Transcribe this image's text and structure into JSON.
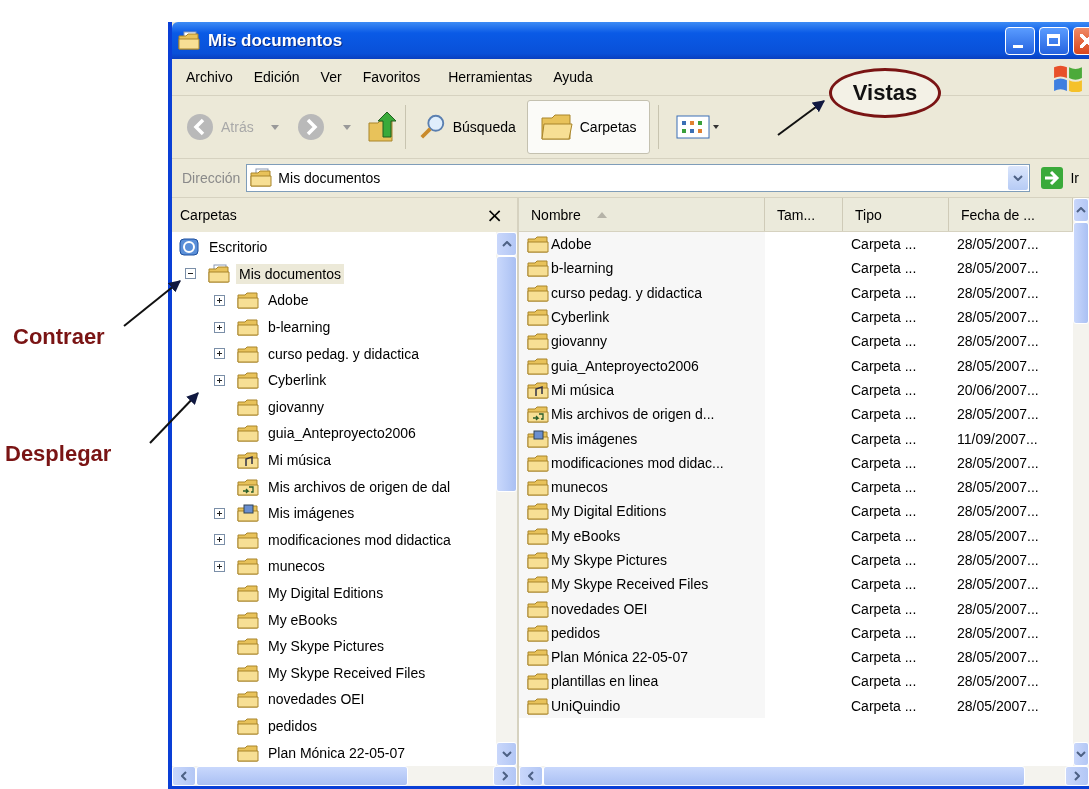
{
  "window": {
    "title": "Mis documentos"
  },
  "menu": [
    "Archivo",
    "Edición",
    "Ver",
    "Favoritos",
    "Herramientas",
    "Ayuda"
  ],
  "toolbar": {
    "back": {
      "label": "Atrás",
      "disabled": true
    },
    "forward": {
      "disabled": true
    },
    "search": {
      "label": "Búsqueda"
    },
    "folders": {
      "label": "Carpetas",
      "selected": true
    }
  },
  "address": {
    "label": "Dirección",
    "value": "Mis documentos",
    "go": "Ir"
  },
  "folders_pane": {
    "title": "Carpetas",
    "close": "×",
    "tree": [
      {
        "label": "Escritorio",
        "kind": "desktop",
        "selected": false,
        "children": [
          {
            "label": "Mis documentos",
            "kind": "documents",
            "selected": true,
            "expanded": true,
            "children": [
              {
                "label": "Adobe",
                "kind": "folder",
                "selected": false,
                "expanded": false
              },
              {
                "label": "b-learning",
                "kind": "folder",
                "selected": false,
                "expanded": false
              },
              {
                "label": "curso pedag. y didactica",
                "kind": "folder",
                "selected": false,
                "expanded": false
              },
              {
                "label": "Cyberlink",
                "kind": "folder",
                "selected": false,
                "expanded": false
              },
              {
                "label": "giovanny",
                "kind": "folder",
                "selected": false
              },
              {
                "label": "guia_Anteproyecto2006",
                "kind": "folder",
                "selected": false
              },
              {
                "label": "Mi música",
                "kind": "music",
                "selected": false
              },
              {
                "label": "Mis archivos de origen de dal",
                "kind": "shared",
                "selected": false
              },
              {
                "label": "Mis imágenes",
                "kind": "pictures",
                "selected": false,
                "expanded": false
              },
              {
                "label": "modificaciones mod didactica",
                "kind": "folder",
                "selected": false,
                "expanded": false
              },
              {
                "label": "munecos",
                "kind": "folder",
                "selected": false,
                "expanded": false
              },
              {
                "label": "My Digital Editions",
                "kind": "folder",
                "selected": false
              },
              {
                "label": "My eBooks",
                "kind": "folder",
                "selected": false
              },
              {
                "label": "My Skype Pictures",
                "kind": "folder",
                "selected": false
              },
              {
                "label": "My Skype Received Files",
                "kind": "folder",
                "selected": false
              },
              {
                "label": "novedades OEI",
                "kind": "folder",
                "selected": false
              },
              {
                "label": "pedidos",
                "kind": "folder",
                "selected": false
              },
              {
                "label": "Plan Mónica 22-05-07",
                "kind": "folder",
                "selected": false
              }
            ]
          }
        ]
      }
    ]
  },
  "file_list": {
    "columns": [
      {
        "label": "Nombre",
        "sorted": true
      },
      {
        "label": "Tam..."
      },
      {
        "label": "Tipo"
      },
      {
        "label": "Fecha de ..."
      }
    ],
    "rows": [
      {
        "name": "Adobe",
        "kind": "folder",
        "type": "Carpeta ...",
        "date": "28/05/2007..."
      },
      {
        "name": "b-learning",
        "kind": "folder",
        "type": "Carpeta ...",
        "date": "28/05/2007..."
      },
      {
        "name": "curso pedag. y didactica",
        "kind": "folder",
        "type": "Carpeta ...",
        "date": "28/05/2007..."
      },
      {
        "name": "Cyberlink",
        "kind": "folder",
        "type": "Carpeta ...",
        "date": "28/05/2007..."
      },
      {
        "name": "giovanny",
        "kind": "folder",
        "type": "Carpeta ...",
        "date": "28/05/2007..."
      },
      {
        "name": "guia_Anteproyecto2006",
        "kind": "folder",
        "type": "Carpeta ...",
        "date": "28/05/2007..."
      },
      {
        "name": "Mi música",
        "kind": "music",
        "type": "Carpeta ...",
        "date": "20/06/2007..."
      },
      {
        "name": "Mis archivos de origen d...",
        "kind": "shared",
        "type": "Carpeta ...",
        "date": "28/05/2007..."
      },
      {
        "name": "Mis imágenes",
        "kind": "pictures",
        "type": "Carpeta ...",
        "date": "11/09/2007..."
      },
      {
        "name": "modificaciones mod didac...",
        "kind": "folder",
        "type": "Carpeta ...",
        "date": "28/05/2007..."
      },
      {
        "name": "munecos",
        "kind": "folder",
        "type": "Carpeta ...",
        "date": "28/05/2007..."
      },
      {
        "name": "My Digital Editions",
        "kind": "folder",
        "type": "Carpeta ...",
        "date": "28/05/2007..."
      },
      {
        "name": "My eBooks",
        "kind": "folder",
        "type": "Carpeta ...",
        "date": "28/05/2007..."
      },
      {
        "name": "My Skype Pictures",
        "kind": "folder",
        "type": "Carpeta ...",
        "date": "28/05/2007..."
      },
      {
        "name": "My Skype Received Files",
        "kind": "folder",
        "type": "Carpeta ...",
        "date": "28/05/2007..."
      },
      {
        "name": "novedades OEI",
        "kind": "folder",
        "type": "Carpeta ...",
        "date": "28/05/2007..."
      },
      {
        "name": "pedidos",
        "kind": "folder",
        "type": "Carpeta ...",
        "date": "28/05/2007..."
      },
      {
        "name": "Plan Mónica 22-05-07",
        "kind": "folder",
        "type": "Carpeta ...",
        "date": "28/05/2007..."
      },
      {
        "name": "plantillas en linea",
        "kind": "folder",
        "type": "Carpeta ...",
        "date": "28/05/2007..."
      },
      {
        "name": "UniQuindio",
        "kind": "folder",
        "type": "Carpeta ...",
        "date": "28/05/2007..."
      }
    ]
  },
  "annotations": [
    {
      "label": "Vistas",
      "kind": "circled"
    },
    {
      "label": "Contraer",
      "kind": "arrow"
    },
    {
      "label": "Desplegar",
      "kind": "arrow"
    }
  ]
}
